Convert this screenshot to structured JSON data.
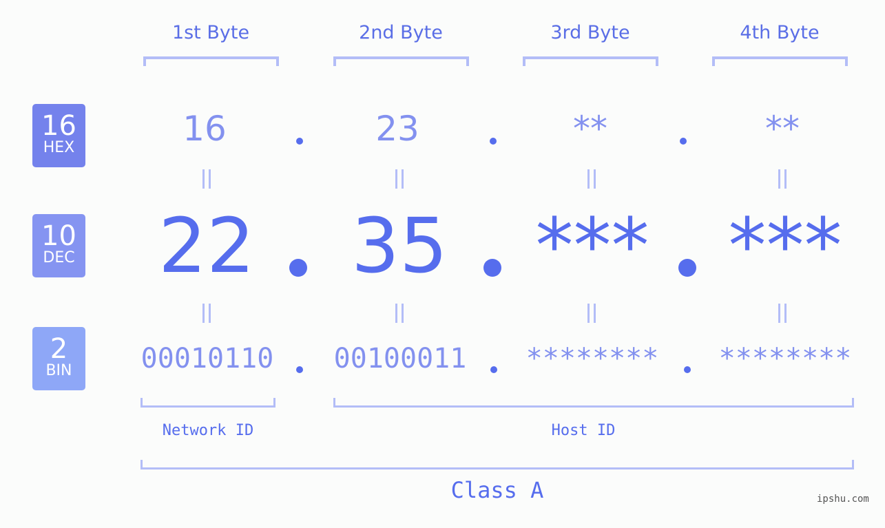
{
  "bytes": {
    "labels": [
      "1st Byte",
      "2nd Byte",
      "3rd Byte",
      "4th Byte"
    ]
  },
  "badges": {
    "hex": {
      "num": "16",
      "label": "HEX",
      "color": "#7482ec"
    },
    "dec": {
      "num": "10",
      "label": "DEC",
      "color": "#8594f1"
    },
    "bin": {
      "num": "2",
      "label": "BIN",
      "color": "#8ea7f7"
    }
  },
  "hex_values": [
    "16",
    "23",
    "**",
    "**"
  ],
  "dec_values": [
    "22",
    "35",
    "***",
    "***"
  ],
  "bin_values": [
    "00010110",
    "00100011",
    "********",
    "********"
  ],
  "separator": ".",
  "ids": {
    "network": "Network ID",
    "host": "Host ID"
  },
  "class_label": "Class A",
  "watermark": "ipshu.com",
  "colors": {
    "accent": "#566ded",
    "light_accent": "#8391ef",
    "bracket": "#b3bdf7",
    "background": "#fbfcfb"
  }
}
